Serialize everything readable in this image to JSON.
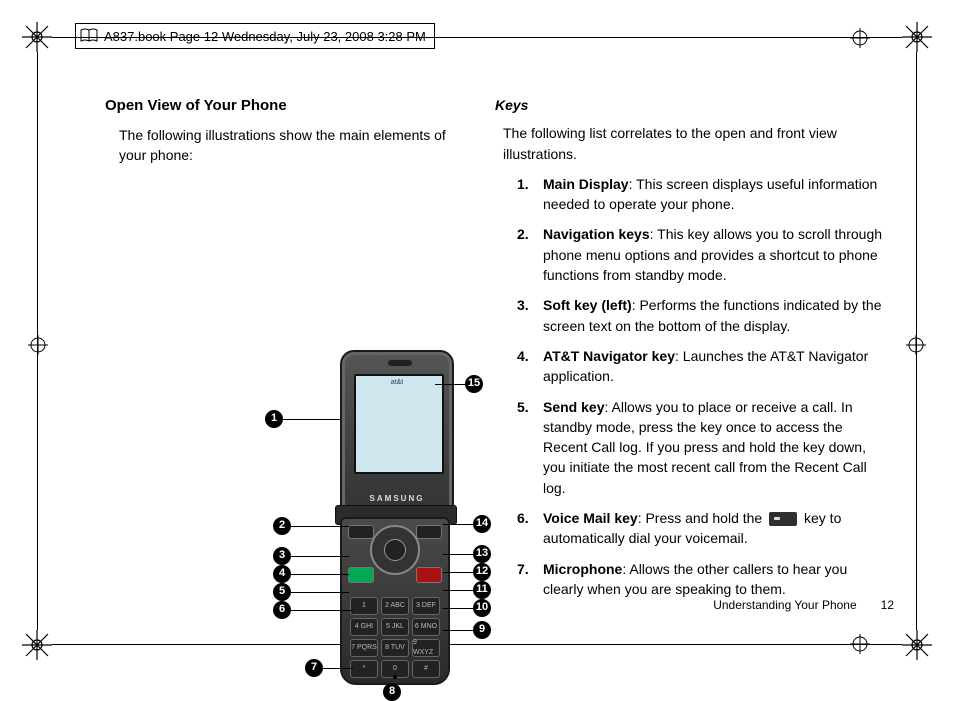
{
  "header": {
    "text": "A837.book  Page 12  Wednesday, July 23, 2008  3:28 PM"
  },
  "left": {
    "heading": "Open View of Your Phone",
    "intro": "The following illustrations show the main elements of your phone:",
    "phone": {
      "carrier_logo": "at&t",
      "brand_label": "SAMSUNG",
      "callouts": [
        "1",
        "2",
        "3",
        "4",
        "5",
        "6",
        "7",
        "8",
        "9",
        "10",
        "11",
        "12",
        "13",
        "14",
        "15"
      ],
      "keypad_labels": [
        "1",
        "2 ABC",
        "3 DEF",
        "4 GHI",
        "5 JKL",
        "6 MNO",
        "7 PQRS",
        "8 TUV",
        "9 WXYZ",
        "*",
        "0",
        "#"
      ]
    }
  },
  "right": {
    "heading": "Keys",
    "intro": "The following list correlates to the open and front view illustrations.",
    "items": [
      {
        "num": "1.",
        "term": "Main Display",
        "desc": ": This screen displays useful information needed to operate your phone."
      },
      {
        "num": "2.",
        "term": "Navigation keys",
        "desc": ": This key allows you to scroll through phone menu options and provides a shortcut to phone functions from standby mode."
      },
      {
        "num": "3.",
        "term": "Soft key (left)",
        "desc": ": Performs the functions indicated by the screen text on the bottom of the display."
      },
      {
        "num": "4.",
        "term": "AT&T Navigator key",
        "desc": ": Launches the AT&T Navigator application."
      },
      {
        "num": "5.",
        "term": "Send key",
        "desc": ": Allows you to place or receive a call. In standby mode, press the key once to access the Recent Call log. If you press and hold the key down, you initiate the most recent call from the Recent Call log."
      },
      {
        "num": "6.",
        "term": "Voice Mail key",
        "desc_before": ": Press and hold the ",
        "desc_after": " key to automatically dial your voicemail."
      },
      {
        "num": "7.",
        "term": "Microphone",
        "desc": ": Allows the other callers to hear you clearly when you are speaking to them."
      }
    ]
  },
  "footer": {
    "section": "Understanding Your Phone",
    "page": "12"
  }
}
